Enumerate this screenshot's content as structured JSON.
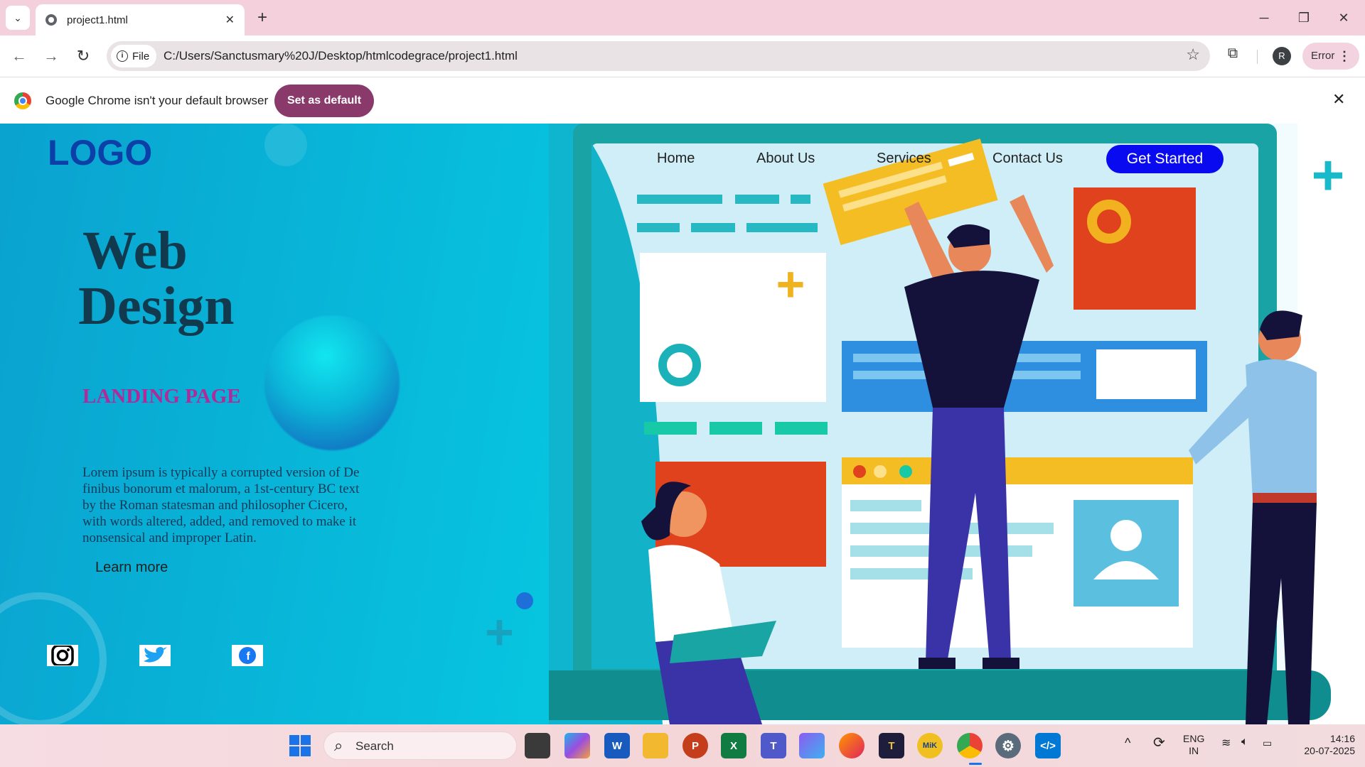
{
  "browser": {
    "tab_title": "project1.html",
    "chip_label": "File",
    "url": "C:/Users/Sanctusmary%20J/Desktop/htmlcodegrace/project1.html",
    "profile_initial": "R",
    "error_label": "Error"
  },
  "infobar": {
    "message": "Google Chrome isn't your default browser",
    "button": "Set as default"
  },
  "page": {
    "logo": "LOGO",
    "nav": [
      "Home",
      "About Us",
      "Services",
      "Contact Us"
    ],
    "cta": "Get Started",
    "hero_line1": "Web",
    "hero_line2": "Design",
    "subtitle": "LANDING PAGE",
    "body": "Lorem ipsum is typically a corrupted version of De finibus bonorum et malorum, a 1st-century BC text by the Roman statesman and philosopher Cicero, with words altered, added, and removed to make it nonsensical and improper Latin.",
    "learn_more": "Learn more",
    "social_icons": [
      "instagram-icon",
      "twitter-icon",
      "facebook-icon"
    ]
  },
  "taskbar": {
    "search_placeholder": "Search",
    "lang_line1": "ENG",
    "lang_line2": "IN",
    "time": "14:16",
    "date": "20-07-2025"
  },
  "colors": {
    "brand_blue": "#0d3fa8",
    "cta_blue": "#0a0af0",
    "subtitle_magenta": "#b02a9a",
    "infobar_button": "#8a3a6a"
  }
}
